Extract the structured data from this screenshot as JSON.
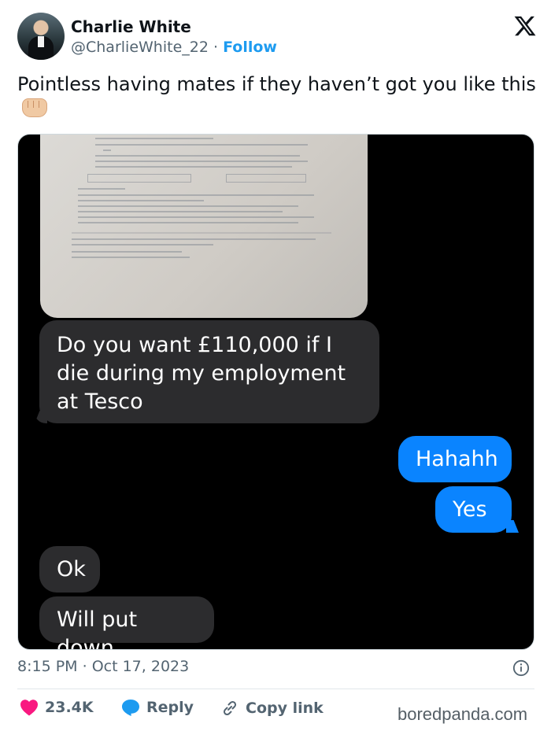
{
  "author": {
    "name": "Charlie White",
    "handle": "@CharlieWhite_22",
    "separator": "·",
    "follow_label": "Follow"
  },
  "tweet": {
    "text": "Pointless having mates if they haven’t got you like this",
    "emoji": "fist-bump-icon"
  },
  "messages": [
    {
      "sender": "them",
      "text": "Do you want £110,000 if I die during my employment at Tesco"
    },
    {
      "sender": "me",
      "text": "Hahahh"
    },
    {
      "sender": "me",
      "text": "Yes"
    },
    {
      "sender": "them",
      "text": "Ok"
    },
    {
      "sender": "them",
      "text": "Will put down"
    }
  ],
  "meta": {
    "time": "8:15 PM",
    "date": "Oct 17, 2023",
    "separator": "·"
  },
  "actions": {
    "likes": "23.4K",
    "reply_label": "Reply",
    "copy_label": "Copy link"
  },
  "watermark": "boredpanda.com",
  "colors": {
    "follow": "#1d9bf0",
    "like": "#f91880",
    "reply": "#1d9bf0",
    "incoming_bubble": "#2c2c2e",
    "outgoing_bubble": "#0a84ff"
  }
}
